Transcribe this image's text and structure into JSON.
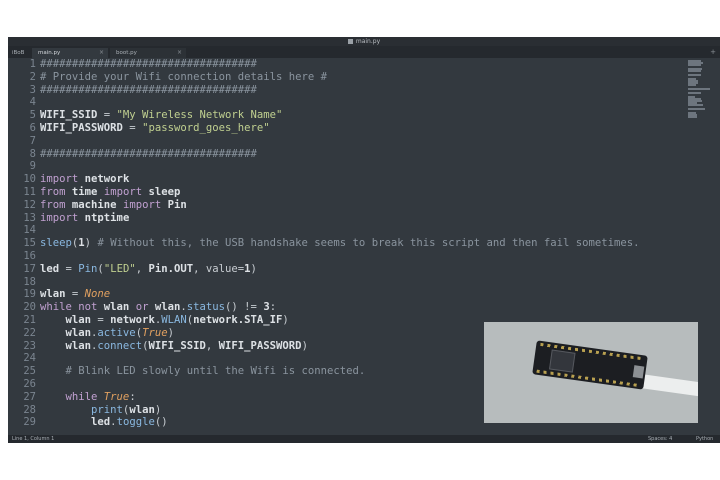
{
  "window": {
    "title": "main.py",
    "tabs": [
      {
        "label": "iBoB",
        "active": false
      },
      {
        "label": "main.py",
        "active": true
      },
      {
        "label": "boot.py",
        "active": false
      }
    ],
    "new_tab_label": "+"
  },
  "status": {
    "left": "Line 1, Column 1",
    "spaces": "Spaces: 4",
    "syntax": "Python"
  },
  "code_lines": [
    {
      "n": "1",
      "html": "<span class='hash'>##################################</span>"
    },
    {
      "n": "2",
      "html": "<span class='cm'># Provide your Wifi connection details here #</span>"
    },
    {
      "n": "3",
      "html": "<span class='hash'>##################################</span>"
    },
    {
      "n": "4",
      "html": ""
    },
    {
      "n": "5",
      "html": "<span class='b'>WIFI_SSID</span> = <span class='str'>\"My Wireless Network Name\"</span>"
    },
    {
      "n": "6",
      "html": "<span class='b'>WIFI_PASSWORD</span> = <span class='str'>\"password_goes_here\"</span>"
    },
    {
      "n": "7",
      "html": ""
    },
    {
      "n": "8",
      "html": "<span class='hash'>##################################</span>"
    },
    {
      "n": "9",
      "html": ""
    },
    {
      "n": "10",
      "html": "<span class='kw'>import</span> <span class='b'>network</span>"
    },
    {
      "n": "11",
      "html": "<span class='kw'>from</span> <span class='b'>time</span> <span class='kw'>import</span> <span class='b'>sleep</span>"
    },
    {
      "n": "12",
      "html": "<span class='kw'>from</span> <span class='b'>machine</span> <span class='kw'>import</span> <span class='b'>Pin</span>"
    },
    {
      "n": "13",
      "html": "<span class='kw'>import</span> <span class='b'>ntptime</span>"
    },
    {
      "n": "14",
      "html": ""
    },
    {
      "n": "15",
      "html": "<span class='fn'>sleep</span>(<span class='b'>1</span>) <span class='cm'># Without this, the USB handshake seems to break this script and then fail sometimes.</span>"
    },
    {
      "n": "16",
      "html": ""
    },
    {
      "n": "17",
      "html": "<span class='b'>led</span> = <span class='fn'>Pin</span>(<span class='str'>\"LED\"</span>, <span class='b'>Pin.OUT</span>, value=<span class='b'>1</span>)"
    },
    {
      "n": "18",
      "html": ""
    },
    {
      "n": "19",
      "html": "<span class='b'>wlan</span> = <span class='bool'>None</span>"
    },
    {
      "n": "20",
      "html": "<span class='kw'>while not</span> <span class='b'>wlan</span> <span class='kw'>or</span> <span class='b'>wlan</span>.<span class='fn'>status</span>() != <span class='b'>3</span>:"
    },
    {
      "n": "21",
      "html": "    <span class='b'>wlan</span> = <span class='b'>network</span>.<span class='fn'>WLAN</span>(<span class='b'>network.STA_IF</span>)"
    },
    {
      "n": "22",
      "html": "    <span class='b'>wlan</span>.<span class='fn'>active</span>(<span class='bool'>True</span>)"
    },
    {
      "n": "23",
      "html": "    <span class='b'>wlan</span>.<span class='fn'>connect</span>(<span class='b'>WIFI_SSID</span>, <span class='b'>WIFI_PASSWORD</span>)"
    },
    {
      "n": "24",
      "html": ""
    },
    {
      "n": "25",
      "html": "    <span class='cm'># Blink LED slowly until the Wifi is connected.</span>"
    },
    {
      "n": "26",
      "html": ""
    },
    {
      "n": "27",
      "html": "    <span class='kw'>while</span> <span class='bool'>True</span>:"
    },
    {
      "n": "28",
      "html": "        <span class='fn'>print</span>(<span class='b'>wlan</span>)"
    },
    {
      "n": "29",
      "html": "        <span class='b'>led</span>.<span class='fn'>toggle</span>()"
    }
  ]
}
